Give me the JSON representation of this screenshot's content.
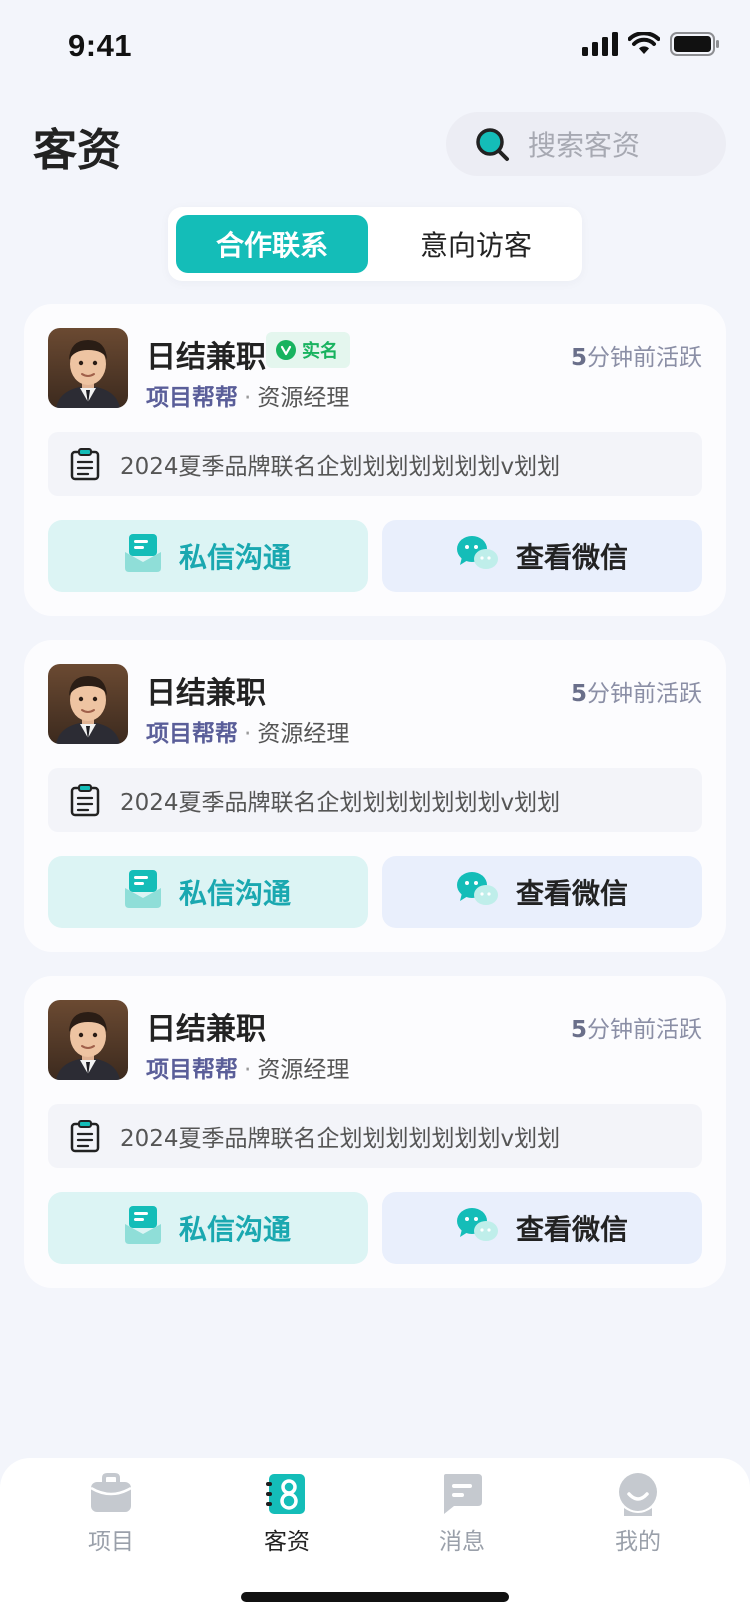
{
  "status_bar": {
    "time": "9:41"
  },
  "header": {
    "title": "客资",
    "search_placeholder": "搜索客资"
  },
  "segments": [
    {
      "label": "合作联系",
      "active": true
    },
    {
      "label": "意向访客",
      "active": false
    }
  ],
  "cards": [
    {
      "name": "日结兼职",
      "verified": true,
      "verified_label": "实名",
      "active_num": "5",
      "active_text": "分钟前活跃",
      "company": "项目帮帮",
      "separator": "·",
      "role": "资源经理",
      "project": "2024夏季品牌联名企划划划划划划划v划划",
      "chat_label": "私信沟通",
      "wechat_label": "查看微信"
    },
    {
      "name": "日结兼职",
      "verified": false,
      "active_num": "5",
      "active_text": "分钟前活跃",
      "company": "项目帮帮",
      "separator": "·",
      "role": "资源经理",
      "project": "2024夏季品牌联名企划划划划划划划v划划",
      "chat_label": "私信沟通",
      "wechat_label": "查看微信"
    },
    {
      "name": "日结兼职",
      "verified": false,
      "active_num": "5",
      "active_text": "分钟前活跃",
      "company": "项目帮帮",
      "separator": "·",
      "role": "资源经理",
      "project": "2024夏季品牌联名企划划划划划划划v划划",
      "chat_label": "私信沟通",
      "wechat_label": "查看微信"
    }
  ],
  "tabbar": [
    {
      "label": "项目",
      "icon": "briefcase-icon",
      "active": false
    },
    {
      "label": "客资",
      "icon": "contacts-book-icon",
      "active": true
    },
    {
      "label": "消息",
      "icon": "message-icon",
      "active": false
    },
    {
      "label": "我的",
      "icon": "profile-icon",
      "active": false
    }
  ],
  "colors": {
    "primary": "#14bdb8",
    "verified_green": "#18b35f",
    "company_text": "#5a5e99",
    "tab_inactive": "#9aa0aa"
  }
}
